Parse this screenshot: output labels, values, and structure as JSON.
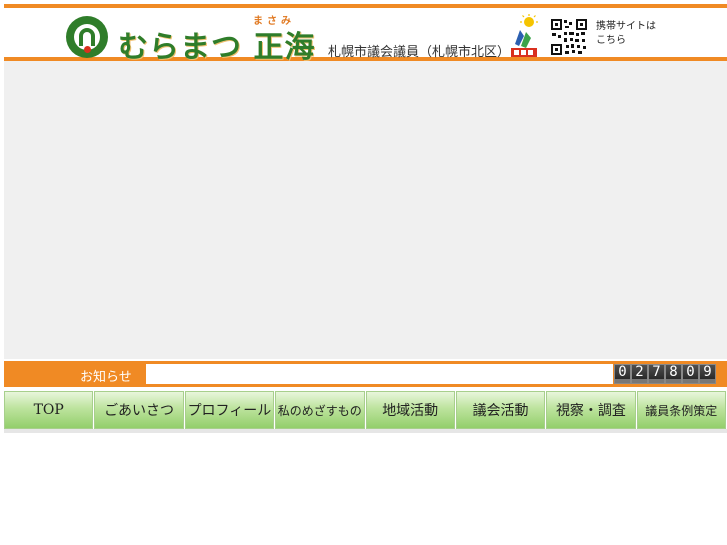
{
  "header": {
    "logo_text": "むらまつ 正海",
    "logo_ruby": "まさみ",
    "subtitle": "札幌市議会議員（札幌市北区）",
    "mobile_site": "携帯サイトは\nこちら",
    "party_icon": "jiminto-logo-icon",
    "qr_icon": "qr-code-icon",
    "brand_color": "#2f7d2a",
    "accent_color": "#f08a24"
  },
  "news": {
    "label": "お知らせ",
    "content": ""
  },
  "counter": {
    "digits": [
      "0",
      "2",
      "7",
      "8",
      "0",
      "9"
    ]
  },
  "nav": {
    "items": [
      {
        "label": "TOP"
      },
      {
        "label": "ごあいさつ"
      },
      {
        "label": "プロフィール"
      },
      {
        "label": "私のめざすもの"
      },
      {
        "label": "地域活動"
      },
      {
        "label": "議会活動"
      },
      {
        "label": "視察・調査"
      },
      {
        "label": "議員条例策定"
      }
    ]
  }
}
